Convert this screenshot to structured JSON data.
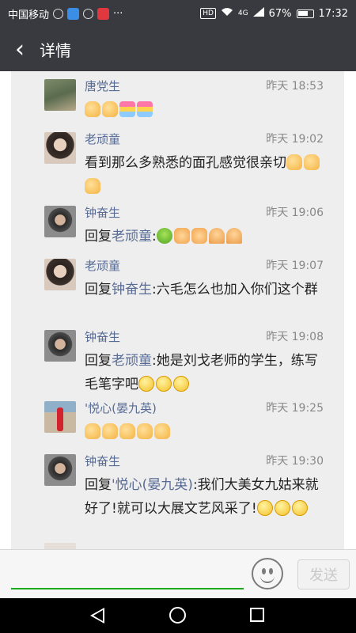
{
  "status_bar": {
    "carrier": "中国移动",
    "network": "4G",
    "hd": "HD",
    "battery": "67%",
    "time": "17:32",
    "more": "···"
  },
  "header": {
    "back_icon": "‹",
    "title": "详情"
  },
  "comments": [
    {
      "name": "唐党生",
      "time": "昨天 18:53",
      "reply_to": "",
      "text": "",
      "emojis": [
        "thumb",
        "thumb",
        "cake",
        "cake"
      ]
    },
    {
      "name": "老顽童",
      "time": "昨天 19:02",
      "reply_to": "",
      "text": "看到那么多熟悉的面孔感觉很亲切",
      "emojis": [
        "thumb",
        "thumb",
        "thumb"
      ]
    },
    {
      "name": "钟奋生",
      "time": "昨天 19:06",
      "reply_prefix": "回复",
      "reply_to": "老顽童",
      "text": ":",
      "emojis": [
        "frog",
        "hshake",
        "hshake",
        "pray",
        "pray"
      ]
    },
    {
      "name": "老顽童",
      "time": "昨天 19:07",
      "reply_prefix": "回复",
      "reply_to": "钟奋生",
      "text": ":六毛怎么也加入你们这个群",
      "emojis": []
    },
    {
      "name": "钟奋生",
      "time": "昨天 19:08",
      "reply_prefix": "回复",
      "reply_to": "老顽童",
      "text": ":她是刘戈老师的学生，练写毛笔字吧",
      "emojis": [
        "smile",
        "smile",
        "smile"
      ]
    },
    {
      "name": "'悦心(晏九英)",
      "time": "昨天 19:25",
      "reply_to": "",
      "text": "",
      "emojis": [
        "thumb",
        "thumb",
        "thumb",
        "thumb",
        "thumb"
      ]
    },
    {
      "name": "钟奋生",
      "time": "昨天 19:30",
      "reply_prefix": "回复",
      "reply_to": "'悦心(晏九英)",
      "text": ":我们大美女九姑来就好了!就可以大展文艺风采了!",
      "emojis": [
        "smile",
        "smile",
        "smile"
      ]
    }
  ],
  "input": {
    "placeholder": "",
    "send_label": "发送"
  },
  "nav": {
    "back": "back",
    "home": "home",
    "recent": "recent"
  }
}
